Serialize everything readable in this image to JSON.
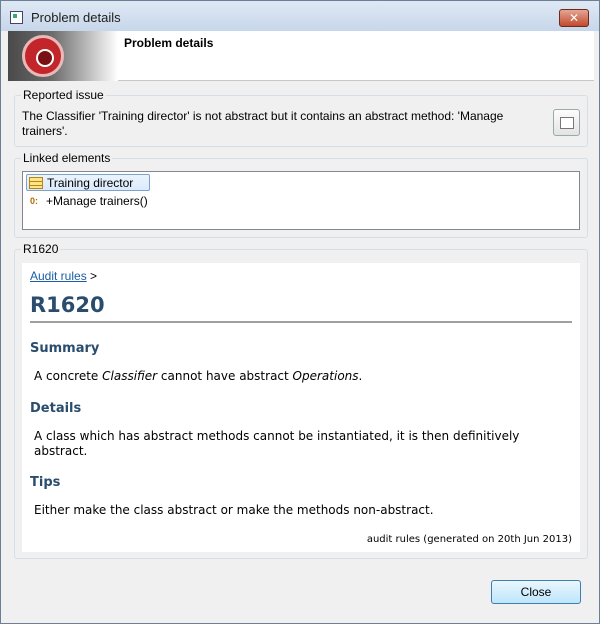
{
  "window": {
    "title": "Problem details"
  },
  "banner": {
    "title": "Problem details"
  },
  "reported_issue": {
    "label": "Reported issue",
    "line1": "The Classifier 'Training director' is not abstract but it contains an abstract method: 'Manage",
    "line2": "trainers'."
  },
  "linked_elements": {
    "label": "Linked elements",
    "items": [
      {
        "label": "Training director",
        "icon": "class-icon"
      },
      {
        "label": "+Manage trainers()",
        "icon": "operation-icon"
      }
    ]
  },
  "rule": {
    "group_label": "R1620",
    "breadcrumb_link": "Audit rules",
    "breadcrumb_sep": ">",
    "title": "R1620",
    "summary_heading": "Summary",
    "summary_a": "A concrete ",
    "summary_b": "Classifier",
    "summary_c": " cannot have abstract ",
    "summary_d": "Operations",
    "summary_e": ".",
    "details_heading": "Details",
    "details_line1": "A class which has abstract methods cannot be instantiated, it is then definitively",
    "details_line2": "abstract.",
    "tips_heading": "Tips",
    "tips_text": "Either make the class abstract or make the methods non-abstract.",
    "footer": "audit rules (generated on 20th Jun 2013)"
  },
  "buttons": {
    "close": "Close"
  }
}
